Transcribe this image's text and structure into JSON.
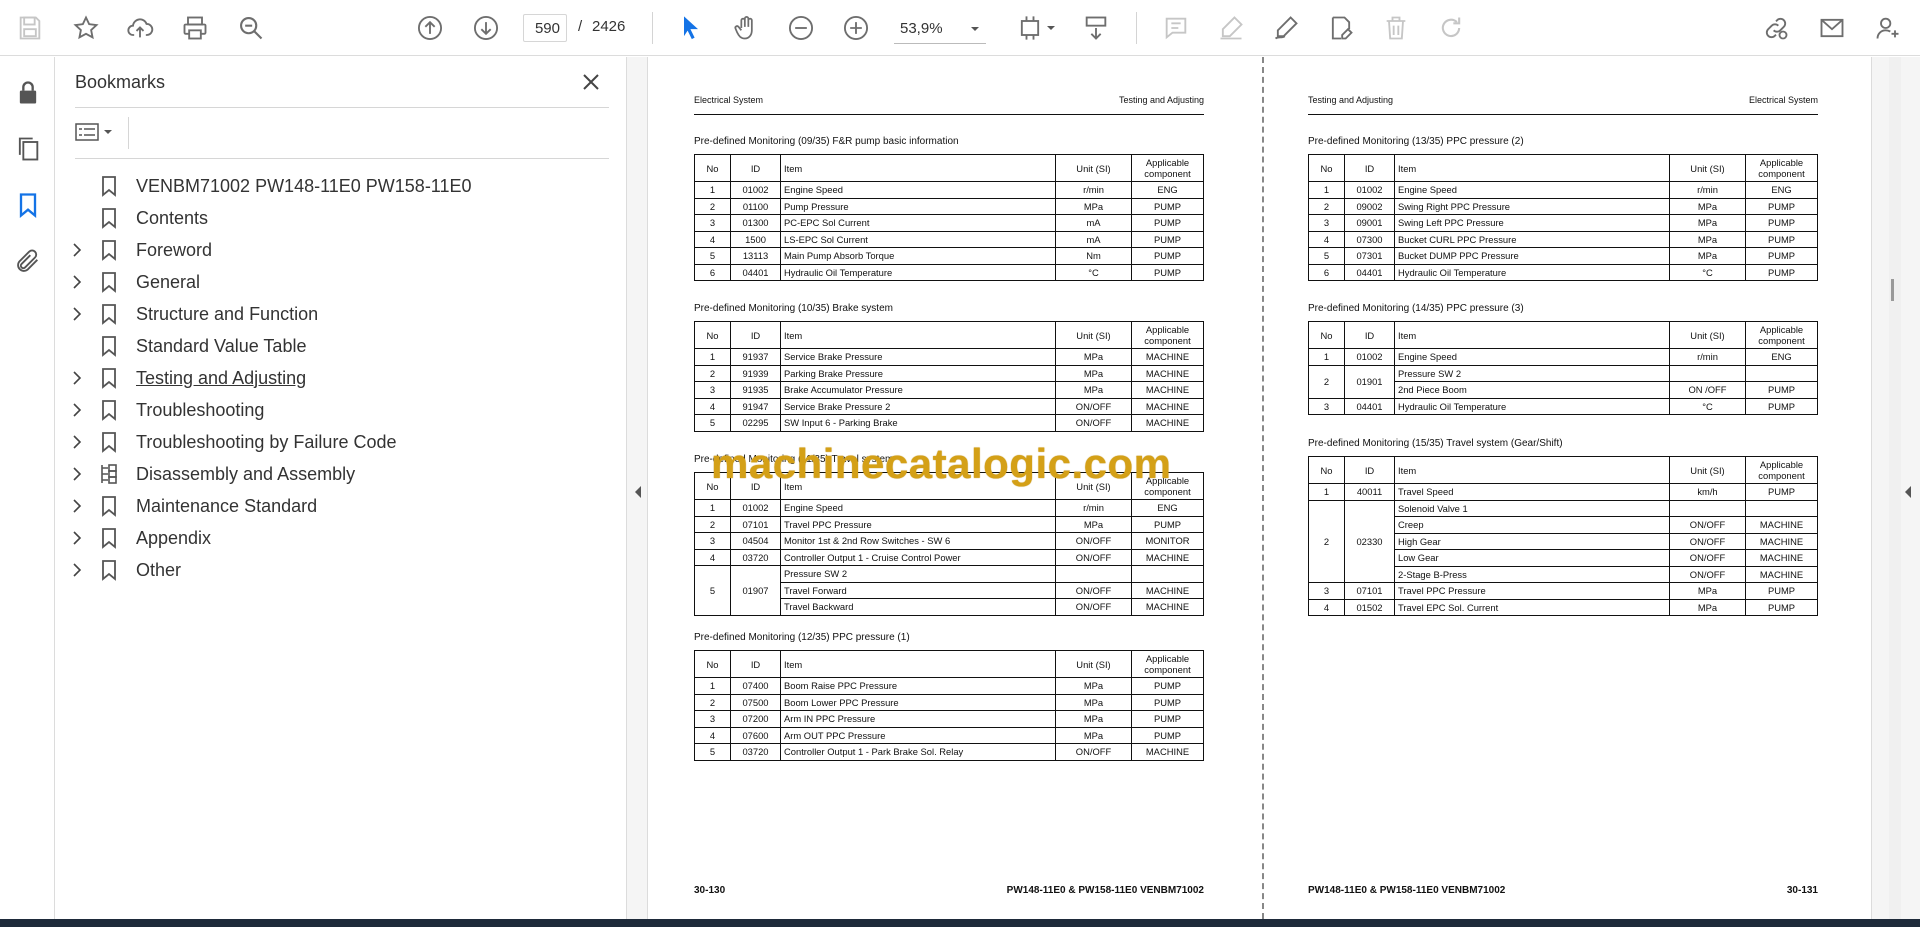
{
  "toolbar": {
    "page_current": "590",
    "page_separator": "/",
    "page_total": "2426",
    "zoom": "53,9%"
  },
  "bookmarks": {
    "title": "Bookmarks",
    "items": [
      {
        "label": "VENBM71002 PW148-11E0 PW158-11E0",
        "expandable": false
      },
      {
        "label": "Contents",
        "expandable": false
      },
      {
        "label": "Foreword",
        "expandable": true
      },
      {
        "label": "General",
        "expandable": true
      },
      {
        "label": "Structure and Function",
        "expandable": true
      },
      {
        "label": "Standard Value Table",
        "expandable": false
      },
      {
        "label": "Testing and Adjusting",
        "expandable": true
      },
      {
        "label": "Troubleshooting",
        "expandable": true
      },
      {
        "label": "Troubleshooting by Failure Code",
        "expandable": true
      },
      {
        "label": "Disassembly and Assembly",
        "expandable": true
      },
      {
        "label": "Maintenance Standard",
        "expandable": true
      },
      {
        "label": "Appendix",
        "expandable": true
      },
      {
        "label": "Other",
        "expandable": true
      }
    ]
  },
  "watermark": "machinecatalogic.com",
  "document": {
    "col_headers": {
      "no": "No",
      "id": "ID",
      "item": "Item",
      "unit": "Unit (SI)",
      "comp1": "Applicable",
      "comp2": "component"
    },
    "left_page": {
      "header_left": "Electrical System",
      "header_right": "Testing and Adjusting",
      "footer_left": "30-130",
      "footer_right": "PW148-11E0 & PW158-11E0   VENBM71002",
      "sections": [
        {
          "title": "Pre-defined Monitoring (09/35) F&R pump basic information",
          "rows": [
            {
              "no": "1",
              "id": "01002",
              "item": "Engine Speed",
              "unit": "r/min",
              "comp": "ENG"
            },
            {
              "no": "2",
              "id": "01100",
              "item": "Pump Pressure",
              "unit": "MPa",
              "comp": "PUMP"
            },
            {
              "no": "3",
              "id": "01300",
              "item": "PC-EPC Sol Current",
              "unit": "mA",
              "comp": "PUMP"
            },
            {
              "no": "4",
              "id": "1500",
              "item": "LS-EPC Sol Current",
              "unit": "mA",
              "comp": "PUMP"
            },
            {
              "no": "5",
              "id": "13113",
              "item": "Main Pump Absorb Torque",
              "unit": "Nm",
              "comp": "PUMP"
            },
            {
              "no": "6",
              "id": "04401",
              "item": "Hydraulic Oil Temperature",
              "unit": "°C",
              "comp": "PUMP"
            }
          ]
        },
        {
          "title": "Pre-defined Monitoring (10/35) Brake system",
          "rows": [
            {
              "no": "1",
              "id": "91937",
              "item": "Service Brake Pressure",
              "unit": "MPa",
              "comp": "MACHINE"
            },
            {
              "no": "2",
              "id": "91939",
              "item": "Parking Brake Pressure",
              "unit": "MPa",
              "comp": "MACHINE"
            },
            {
              "no": "3",
              "id": "91935",
              "item": "Brake Accumulator Pressure",
              "unit": "MPa",
              "comp": "MACHINE"
            },
            {
              "no": "4",
              "id": "91947",
              "item": "Service Brake Pressure 2",
              "unit": "ON/OFF",
              "comp": "MACHINE"
            },
            {
              "no": "5",
              "id": "02295",
              "item": "SW Input 6 - Parking Brake",
              "unit": "ON/OFF",
              "comp": "MACHINE"
            }
          ]
        },
        {
          "title": "Pre-defined Monitoring (11/35) Travel system",
          "rows": [
            {
              "no": "1",
              "id": "01002",
              "item": "Engine Speed",
              "unit": "r/min",
              "comp": "ENG"
            },
            {
              "no": "2",
              "id": "07101",
              "item": "Travel PPC Pressure",
              "unit": "MPa",
              "comp": "PUMP"
            },
            {
              "no": "3",
              "id": "04504",
              "item": "Monitor 1st & 2nd Row Switches - SW 6",
              "unit": "ON/OFF",
              "comp": "MONITOR"
            },
            {
              "no": "4",
              "id": "03720",
              "item": "Controller Output 1 - Cruise Control Power",
              "unit": "ON/OFF",
              "comp": "MACHINE"
            },
            {
              "no": "5",
              "id": "01907",
              "item": "Pressure SW 2",
              "unit": "",
              "comp": "",
              "group_start": true,
              "span": 3
            },
            {
              "no": "",
              "id": "",
              "item": "Travel Forward",
              "unit": "ON/OFF",
              "comp": "MACHINE",
              "in_group": true
            },
            {
              "no": "",
              "id": "",
              "item": "Travel Backward",
              "unit": "ON/OFF",
              "comp": "MACHINE",
              "in_group": true
            }
          ]
        },
        {
          "title": "Pre-defined Monitoring (12/35) PPC pressure (1)",
          "rows": [
            {
              "no": "1",
              "id": "07400",
              "item": "Boom Raise PPC Pressure",
              "unit": "MPa",
              "comp": "PUMP"
            },
            {
              "no": "2",
              "id": "07500",
              "item": "Boom Lower PPC Pressure",
              "unit": "MPa",
              "comp": "PUMP"
            },
            {
              "no": "3",
              "id": "07200",
              "item": "Arm IN PPC Pressure",
              "unit": "MPa",
              "comp": "PUMP"
            },
            {
              "no": "4",
              "id": "07600",
              "item": "Arm OUT PPC Pressure",
              "unit": "MPa",
              "comp": "PUMP"
            },
            {
              "no": "5",
              "id": "03720",
              "item": "Controller Output 1 - Park Brake Sol. Relay",
              "unit": "ON/OFF",
              "comp": "MACHINE"
            }
          ]
        }
      ]
    },
    "right_page": {
      "header_left": "Testing and Adjusting",
      "header_right": "Electrical System",
      "footer_left": "PW148-11E0 & PW158-11E0   VENBM71002",
      "footer_right": "30-131",
      "sections": [
        {
          "title": "Pre-defined Monitoring (13/35) PPC pressure (2)",
          "rows": [
            {
              "no": "1",
              "id": "01002",
              "item": "Engine Speed",
              "unit": "r/min",
              "comp": "ENG"
            },
            {
              "no": "2",
              "id": "09002",
              "item": "Swing Right PPC Pressure",
              "unit": "MPa",
              "comp": "PUMP"
            },
            {
              "no": "3",
              "id": "09001",
              "item": "Swing Left PPC Pressure",
              "unit": "MPa",
              "comp": "PUMP"
            },
            {
              "no": "4",
              "id": "07300",
              "item": "Bucket CURL PPC Pressure",
              "unit": "MPa",
              "comp": "PUMP"
            },
            {
              "no": "5",
              "id": "07301",
              "item": "Bucket DUMP PPC Pressure",
              "unit": "MPa",
              "comp": "PUMP"
            },
            {
              "no": "6",
              "id": "04401",
              "item": "Hydraulic Oil Temperature",
              "unit": "°C",
              "comp": "PUMP"
            }
          ]
        },
        {
          "title": "Pre-defined Monitoring (14/35) PPC pressure (3)",
          "rows": [
            {
              "no": "1",
              "id": "01002",
              "item": "Engine Speed",
              "unit": "r/min",
              "comp": "ENG"
            },
            {
              "no": "2",
              "id": "01901",
              "item": "Pressure SW 2",
              "unit": "",
              "comp": "",
              "group_start": true,
              "span": 2
            },
            {
              "no": "",
              "id": "",
              "item": "2nd Piece Boom",
              "unit": "ON /OFF",
              "comp": "PUMP",
              "in_group": true
            },
            {
              "no": "3",
              "id": "04401",
              "item": "Hydraulic Oil Temperature",
              "unit": "°C",
              "comp": "PUMP"
            }
          ]
        },
        {
          "title": "Pre-defined Monitoring (15/35) Travel system (Gear/Shift)",
          "rows": [
            {
              "no": "1",
              "id": "40011",
              "item": "Travel Speed",
              "unit": "km/h",
              "comp": "PUMP"
            },
            {
              "no": "2",
              "id": "02330",
              "item": "Solenoid Valve 1",
              "unit": "",
              "comp": "",
              "group_start": true,
              "span": 5
            },
            {
              "no": "",
              "id": "",
              "item": "Creep",
              "unit": "ON/OFF",
              "comp": "MACHINE",
              "in_group": true
            },
            {
              "no": "",
              "id": "",
              "item": "High Gear",
              "unit": "ON/OFF",
              "comp": "MACHINE",
              "in_group": true
            },
            {
              "no": "",
              "id": "",
              "item": "Low Gear",
              "unit": "ON/OFF",
              "comp": "MACHINE",
              "in_group": true
            },
            {
              "no": "",
              "id": "",
              "item": "2-Stage B-Press",
              "unit": "ON/OFF",
              "comp": "MACHINE",
              "in_group": true
            },
            {
              "no": "3",
              "id": "07101",
              "item": "Travel PPC Pressure",
              "unit": "MPa",
              "comp": "PUMP"
            },
            {
              "no": "4",
              "id": "01502",
              "item": "Travel EPC Sol. Current",
              "unit": "MPa",
              "comp": "PUMP"
            }
          ]
        }
      ]
    }
  },
  "colors": {
    "accent": "#1473e6",
    "watermark": "#d4a017",
    "icon": "#6e6e6e",
    "icon_disabled": "#c6c6c6"
  }
}
